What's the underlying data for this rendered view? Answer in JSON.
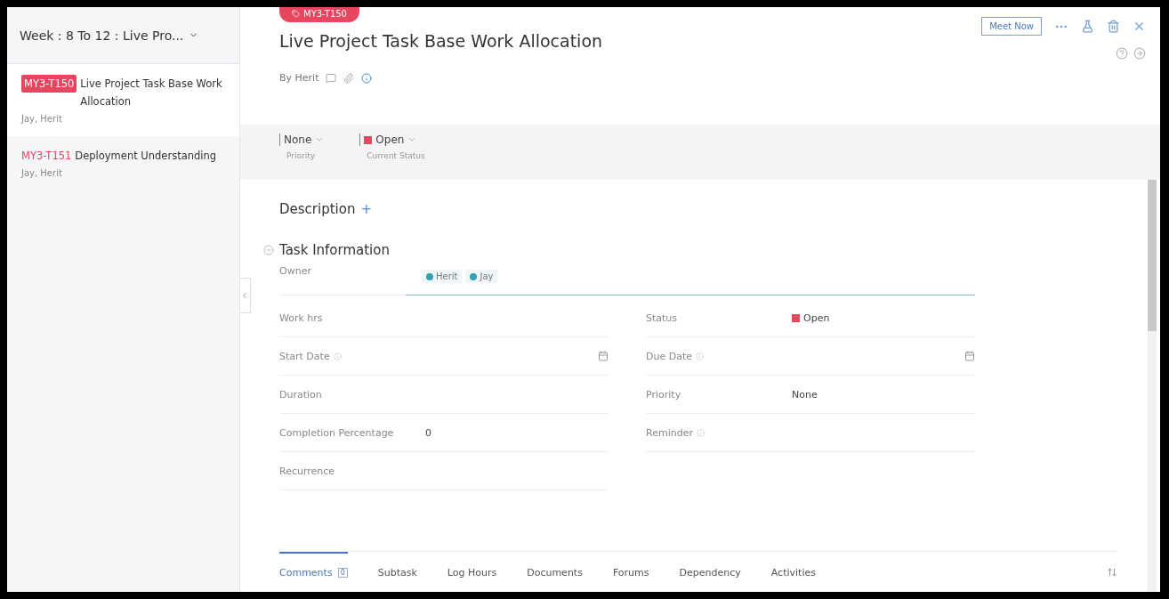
{
  "sidebar": {
    "title": "Week : 8 To 12 : Live Pro...",
    "items": [
      {
        "id": "MY3-T150",
        "title": "Live Project Task Base Work Allocation",
        "people": "Jay, Herit",
        "selected": true
      },
      {
        "id": "MY3-T151",
        "title": "Deployment Understanding",
        "people": "Jay, Herit",
        "selected": false
      }
    ]
  },
  "task": {
    "badge": "MY3-T150",
    "title": "Live Project Task Base Work Allocation",
    "by": "By Herit",
    "meet_button": "Meet Now",
    "quick": [
      {
        "value": "None",
        "label": "Priority"
      },
      {
        "value": "Open",
        "label": "Current Status",
        "color": "#e8455f"
      }
    ]
  },
  "description": "Description",
  "description_add": "+",
  "section": "Task Information",
  "owner_label": "Owner",
  "owners": [
    "Herit",
    "Jay"
  ],
  "fields": [
    {
      "label": "Work hrs",
      "kind": "text"
    },
    {
      "label": "Status",
      "value": "Open",
      "kind": "text",
      "color": "#e8455f"
    },
    {
      "label": "Start Date",
      "kind": "date",
      "info": true
    },
    {
      "label": "Due Date",
      "kind": "date",
      "info": true
    },
    {
      "label": "Duration",
      "kind": "text"
    },
    {
      "label": "Priority",
      "value": "None",
      "kind": "text"
    },
    {
      "label": "Completion Percentage",
      "value": "0",
      "kind": "text"
    },
    {
      "label": "Reminder",
      "kind": "text",
      "info": true
    },
    {
      "label": "Recurrence",
      "kind": "text"
    }
  ],
  "tabs": [
    {
      "label": "Comments",
      "count": "0",
      "selected": true
    },
    {
      "label": "Subtask",
      "selected": false
    },
    {
      "label": "Log Hours",
      "selected": false
    },
    {
      "label": "Documents",
      "selected": false
    },
    {
      "label": "Forums",
      "selected": false
    },
    {
      "label": "Dependency",
      "selected": false
    },
    {
      "label": "Activities",
      "selected": false
    }
  ]
}
